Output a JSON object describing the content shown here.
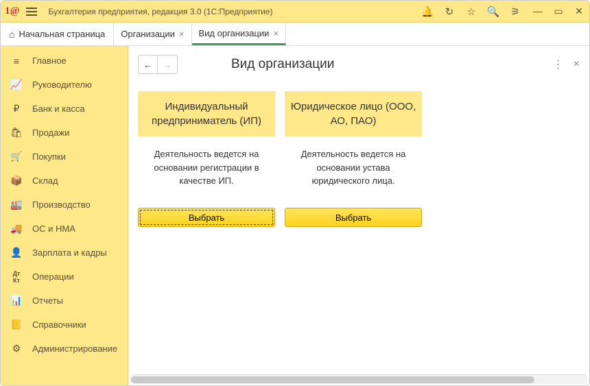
{
  "titlebar": {
    "title": "Бухгалтерия предприятия, редакция 3.0  (1С:Предприятие)"
  },
  "tabs": {
    "home": "Начальная страница",
    "items": [
      {
        "label": "Организации",
        "active": false
      },
      {
        "label": "Вид организации",
        "active": true
      }
    ]
  },
  "sidebar": {
    "items": [
      {
        "icon": "≡",
        "label": "Главное"
      },
      {
        "icon": "📈",
        "label": "Руководителю"
      },
      {
        "icon": "₽",
        "label": "Банк и касса"
      },
      {
        "icon": "🛍",
        "label": "Продажи"
      },
      {
        "icon": "🛒",
        "label": "Покупки"
      },
      {
        "icon": "📦",
        "label": "Склад"
      },
      {
        "icon": "🏭",
        "label": "Производство"
      },
      {
        "icon": "🚚",
        "label": "ОС и НМА"
      },
      {
        "icon": "👤",
        "label": "Зарплата и кадры"
      },
      {
        "icon": "Дт",
        "label": "Операции"
      },
      {
        "icon": "📊",
        "label": "Отчеты"
      },
      {
        "icon": "📒",
        "label": "Справочники"
      },
      {
        "icon": "⚙",
        "label": "Администрирование"
      }
    ]
  },
  "content": {
    "title": "Вид организации",
    "options": [
      {
        "heading": "Индивидуальный предприниматель (ИП)",
        "desc": "Деятельность ведется на основании регистрации в качестве ИП.",
        "button": "Выбрать",
        "selected": true
      },
      {
        "heading": "Юридическое лицо (ООО, АО, ПАО)",
        "desc": "Деятельность ведется на основании устава юридического лица.",
        "button": "Выбрать",
        "selected": false
      }
    ]
  }
}
